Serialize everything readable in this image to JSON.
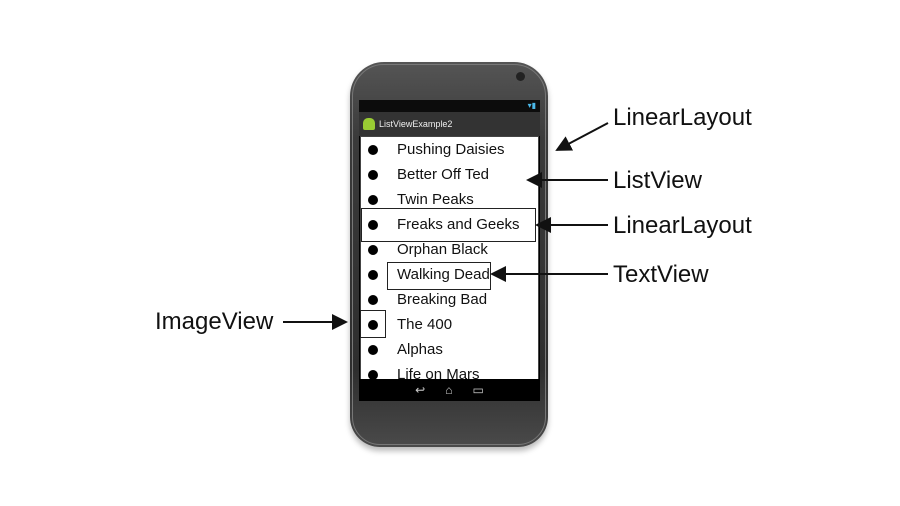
{
  "app_title": "ListViewExample2",
  "list_items": [
    "Pushing Daisies",
    "Better Off Ted",
    "Twin Peaks",
    "Freaks and Geeks",
    "Orphan Black",
    "Walking Dead",
    "Breaking Bad",
    "The 400",
    "Alphas",
    "Life on Mars"
  ],
  "nav_icons": [
    "back-icon",
    "home-icon",
    "recent-apps-icon"
  ],
  "annotations": {
    "outer_layout": "LinearLayout",
    "list_view": "ListView",
    "row_layout": "LinearLayout",
    "text_view": "TextView",
    "image_view": "ImageView"
  }
}
